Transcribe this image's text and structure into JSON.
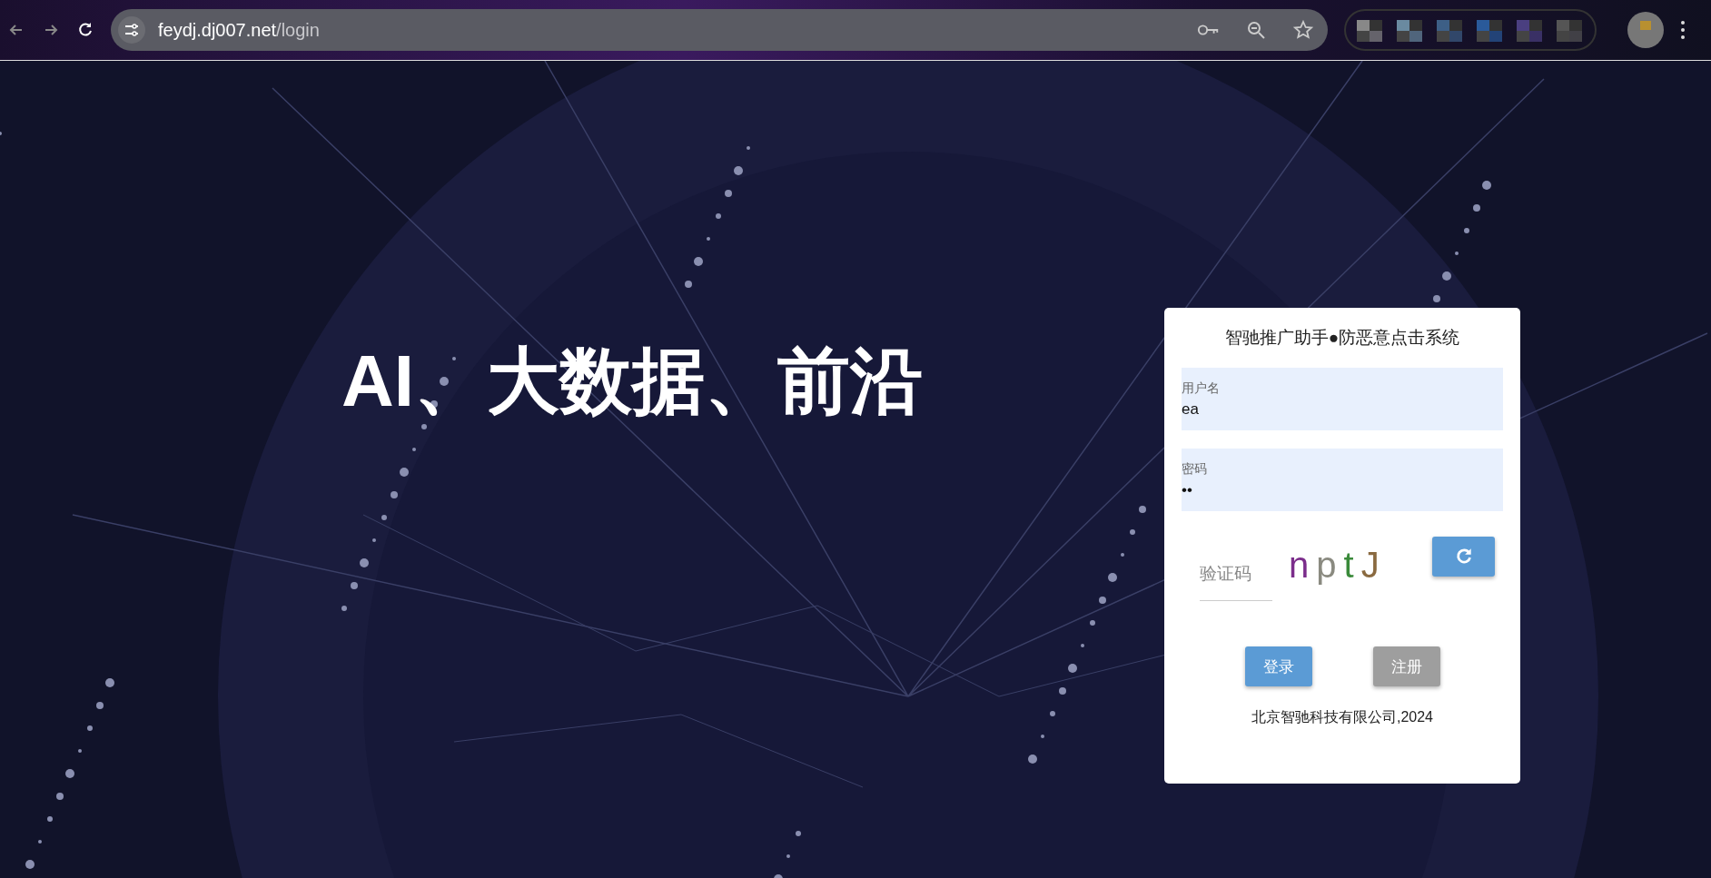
{
  "browser": {
    "url_host": "feydj.dj007.net",
    "url_path": "/login"
  },
  "headline": "AI、大数据、前沿",
  "login": {
    "title": "智驰推广助手●防恶意点击系统",
    "username": {
      "label": "用户名",
      "value": "ea"
    },
    "password": {
      "label": "密码",
      "value": "••"
    },
    "captcha": {
      "placeholder": "验证码",
      "chars": [
        {
          "text": "n",
          "color": "#7b2d8b"
        },
        {
          "text": "p",
          "color": "#8a8a80"
        },
        {
          "text": "t",
          "color": "#3a8a3a"
        },
        {
          "text": "J",
          "color": "#8a6a40"
        }
      ]
    },
    "buttons": [
      {
        "label": "登录",
        "kind": "primary"
      },
      {
        "label": "注册",
        "kind": "secondary"
      }
    ],
    "footer": "北京智驰科技有限公司,2024"
  }
}
